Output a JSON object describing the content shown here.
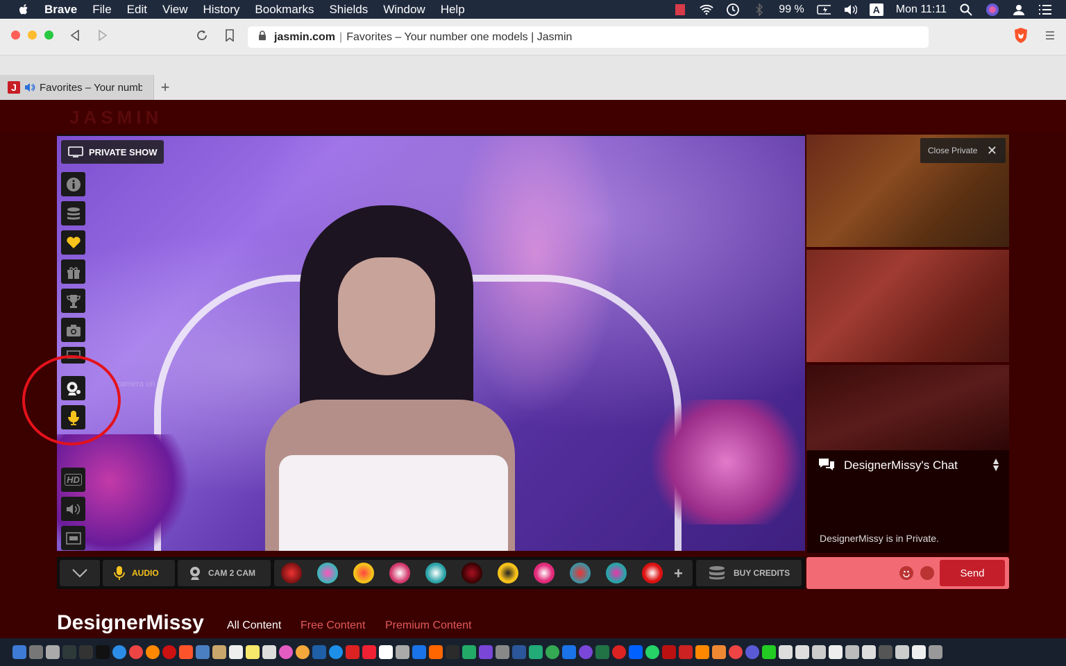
{
  "menubar": {
    "app_name": "Brave",
    "items": [
      "File",
      "Edit",
      "View",
      "History",
      "Bookmarks",
      "Shields",
      "Window",
      "Help"
    ],
    "battery": "99 %",
    "clock": "Mon 11:11",
    "input_source": "A"
  },
  "browser": {
    "url_domain": "jasmin.com",
    "url_title": "Favorites – Your number one models | Jasmin",
    "tab_title": "Favorites – Your numb",
    "tab_favicon_letter": "J"
  },
  "site": {
    "logo": "JASMIN"
  },
  "player": {
    "private_show_label": "PRIVATE SHOW",
    "camera_hint": "camera on",
    "hd_label": "HD"
  },
  "rail": {
    "close_private_label": "Close Private"
  },
  "chat": {
    "title": "DesignerMissy's Chat",
    "message": "DesignerMissy is in Private.",
    "send_label": "Send"
  },
  "controls": {
    "audio_label": "AUDIO",
    "cam2cam_label": "CAM 2 CAM",
    "buy_credits_label": "BUY CREDITS",
    "more_label": "+"
  },
  "profile": {
    "model_name": "DesignerMissy",
    "tabs": [
      "All Content",
      "Free Content",
      "Premium Content"
    ]
  },
  "colors": {
    "accent_red": "#c41e2a",
    "accent_yellow": "#f6c21b",
    "annotation_circle": "#e4121a",
    "page_bg": "#3b0000"
  }
}
